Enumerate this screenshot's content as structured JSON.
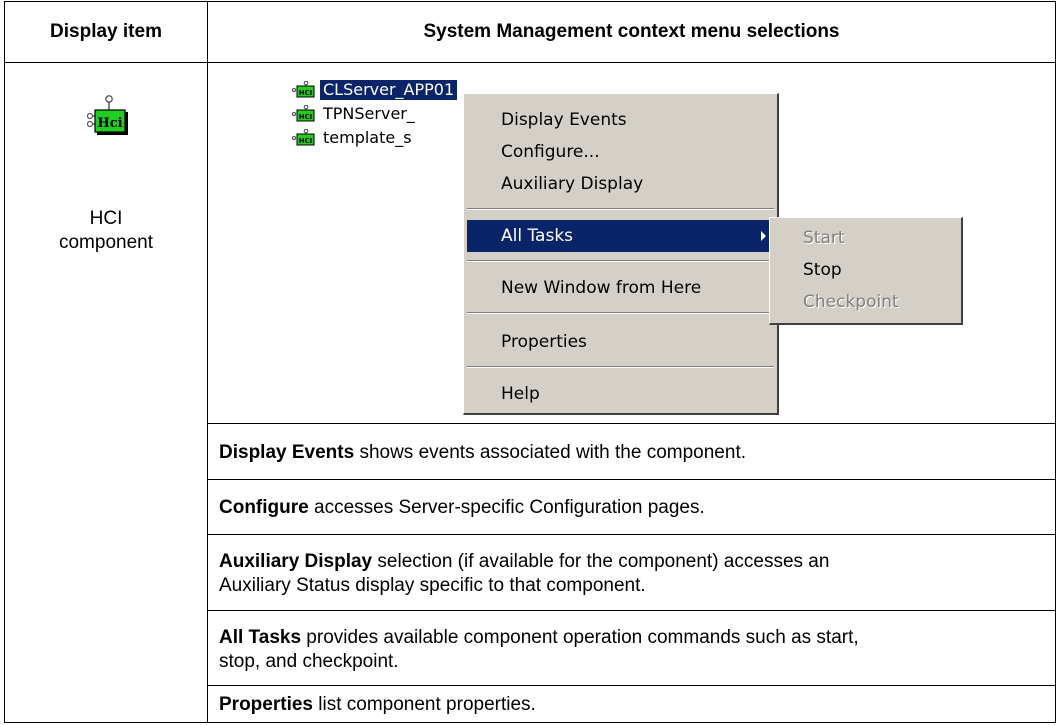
{
  "table": {
    "header_item": "Display item",
    "header_menu": "System Management context menu selections"
  },
  "display_item": {
    "icon": "hci-component-icon",
    "icon_text": "Hci",
    "label_line1": "HCI",
    "label_line2": "component"
  },
  "tree": {
    "items": [
      {
        "label": "CLServer_APP01",
        "selected": true
      },
      {
        "label": "TPNServer_"
      },
      {
        "label": "template_s"
      }
    ],
    "icon_text": "HCI"
  },
  "context_menu": {
    "items": [
      "Display Events",
      "Configure...",
      "Auxiliary Display",
      "All Tasks",
      "New Window from Here",
      "Properties",
      "Help"
    ]
  },
  "submenu": {
    "items": [
      "Start",
      "Stop",
      "Checkpoint"
    ]
  },
  "descriptions": [
    {
      "term": "Display Events",
      "text": " shows events associated with the component."
    },
    {
      "term": "Configure",
      "text": " accesses Server-specific Configuration pages."
    },
    {
      "term": "Auxiliary Display",
      "text": " selection (if available for the component) accesses an Auxiliary Status display specific to that component."
    },
    {
      "term": "All Tasks",
      "text": " provides available component operation commands such as start, stop, and checkpoint."
    },
    {
      "term": "Properties",
      "text": " list component properties."
    }
  ],
  "colors": {
    "selection": "#0a246a",
    "menu_bg": "#d4d0c8",
    "icon_green": "#22cc22"
  }
}
